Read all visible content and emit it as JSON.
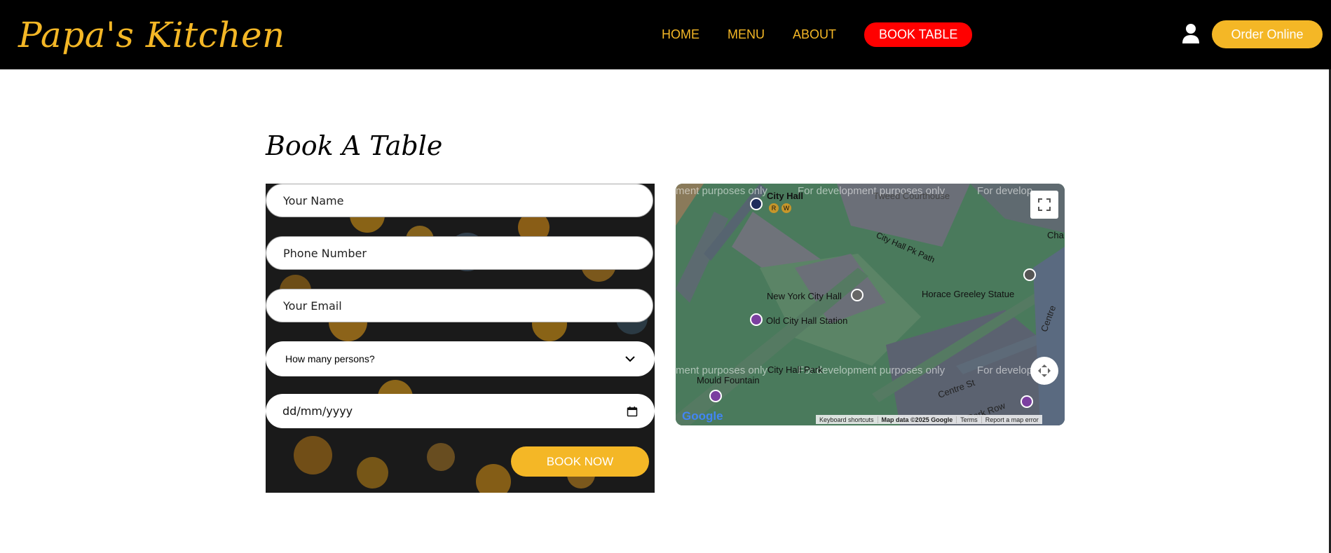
{
  "header": {
    "brand": "Papa's Kitchen",
    "nav": [
      {
        "label": "HOME"
      },
      {
        "label": "MENU"
      },
      {
        "label": "ABOUT"
      },
      {
        "label": "BOOK TABLE",
        "active": true
      }
    ],
    "user_icon": "user-icon",
    "order_button": "Order Online"
  },
  "book": {
    "title": "Book A Table",
    "name_placeholder": "Your Name",
    "phone_placeholder": "Phone Number",
    "email_placeholder": "Your Email",
    "persons_select": "How many persons?",
    "date_placeholder": "dd/mm/yyyy",
    "submit_label": "BOOK NOW"
  },
  "map": {
    "labels": {
      "city_hall": "City Hall",
      "tweed": "Tweed Courthouse",
      "path": "City Hall Pk Path",
      "nych": "New York City Hall",
      "greeley": "Horace Greeley Statue",
      "station": "Old City Hall Station",
      "park": "City Hall Park",
      "fountain": "Mould Fountain",
      "centre": "Centre St",
      "park_row": "Park Row",
      "cha": "Cha",
      "centre_v": "Centre"
    },
    "subway_lines": [
      "R",
      "W"
    ],
    "dev_watermark": "For development purposes only",
    "dev_watermark_cut": "ment purposes only",
    "dev_watermark_right": "For develop",
    "google": "Google",
    "attribution": {
      "shortcuts": "Keyboard shortcuts",
      "data": "Map data ©2025 Google",
      "terms": "Terms",
      "report": "Report a map error"
    },
    "colors": {
      "park": "#4a7a5c",
      "building": "#6b6f78",
      "road": "#5a6e6a",
      "poi": "#7b3fa0"
    }
  },
  "colors": {
    "brand": "#f4b726",
    "nav_active": "#ff0000",
    "header_bg": "#000000"
  }
}
